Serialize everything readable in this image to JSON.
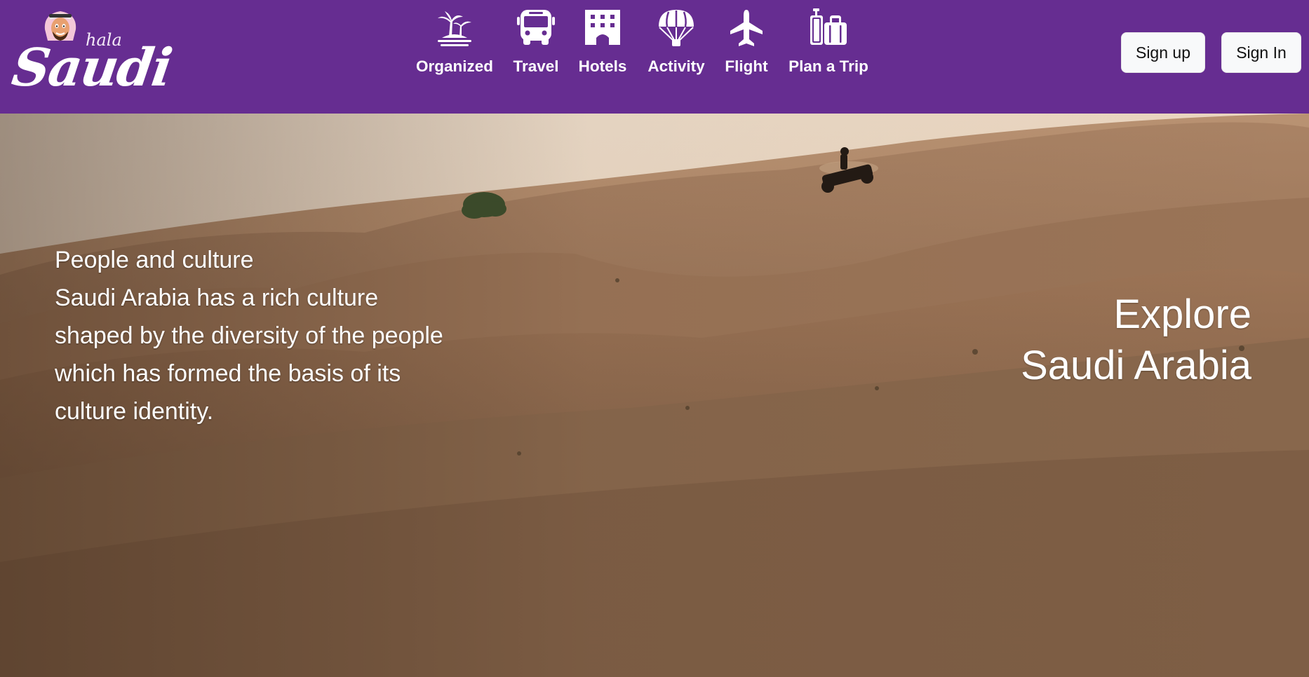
{
  "brand": {
    "small_text": "hala",
    "big_text": "Saudi",
    "mascot_icon": "saudi-man-mascot"
  },
  "nav": {
    "items": [
      {
        "label": "Organized",
        "icon": "palm-island-icon"
      },
      {
        "label": "Travel",
        "icon": "bus-icon"
      },
      {
        "label": "Hotels",
        "icon": "hotel-icon"
      },
      {
        "label": "Activity",
        "icon": "parachute-icon"
      },
      {
        "label": "Flight",
        "icon": "plane-icon"
      },
      {
        "label": "Plan a Trip",
        "icon": "luggage-icon"
      }
    ]
  },
  "auth": {
    "signup_label": "Sign up",
    "signin_label": "Sign In"
  },
  "hero": {
    "heading": "People and culture",
    "body_lines": [
      "Saudi Arabia has a rich culture",
      "shaped by the diversity of the people",
      "which has formed the basis of its",
      "culture identity."
    ],
    "explore_line1": "Explore",
    "explore_line2": "Saudi Arabia"
  },
  "colors": {
    "header_bg": "#662d91",
    "button_bg": "#f8f9fa",
    "sand_dark": "#7a5a40",
    "sky_light": "#efe2d2"
  }
}
